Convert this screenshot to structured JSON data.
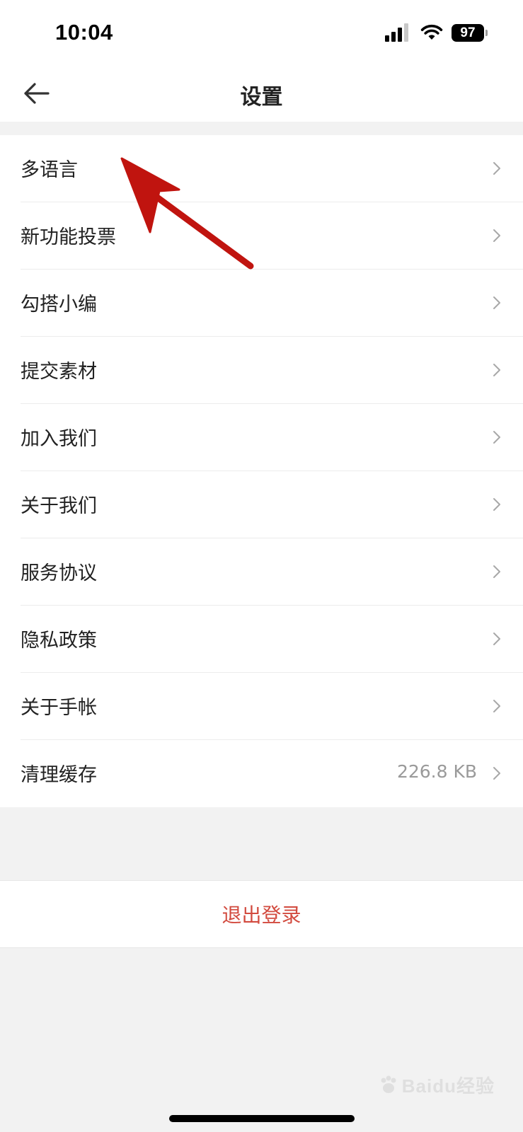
{
  "status_bar": {
    "time": "10:04",
    "battery": "97",
    "icons": [
      "signal-icon",
      "wifi-icon",
      "battery-icon"
    ]
  },
  "nav": {
    "title": "设置",
    "back_icon": "back-arrow-icon"
  },
  "settings": [
    {
      "label": "多语言",
      "value": ""
    },
    {
      "label": "新功能投票",
      "value": ""
    },
    {
      "label": "勾搭小编",
      "value": ""
    },
    {
      "label": "提交素材",
      "value": ""
    },
    {
      "label": "加入我们",
      "value": ""
    },
    {
      "label": "关于我们",
      "value": ""
    },
    {
      "label": "服务协议",
      "value": ""
    },
    {
      "label": "隐私政策",
      "value": ""
    },
    {
      "label": "关于手帐",
      "value": ""
    },
    {
      "label": "清理缓存",
      "value": "226.8 KB"
    }
  ],
  "logout": {
    "label": "退出登录",
    "color": "#d24a3e"
  },
  "annotation": {
    "color": "#c0140f",
    "target": "多语言"
  },
  "watermark": "Baidu经验",
  "colors": {
    "background": "#f2f2f2",
    "surface": "#ffffff",
    "secondary_text": "#9a9a9a"
  }
}
